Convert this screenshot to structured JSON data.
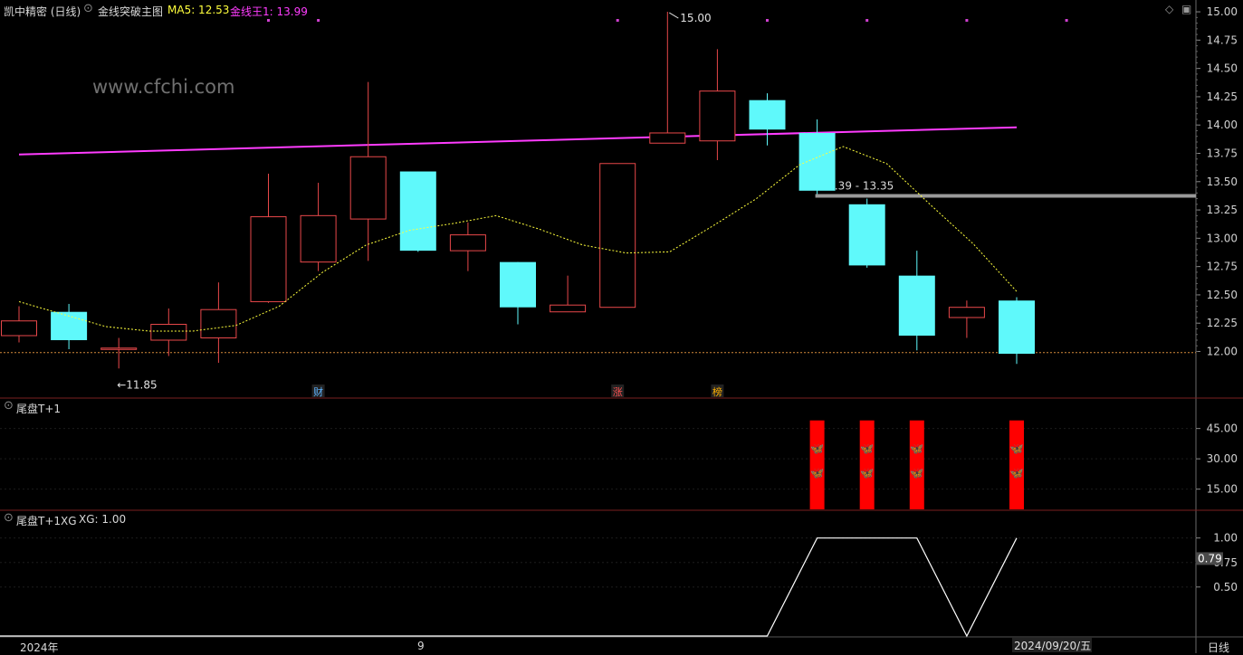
{
  "header": {
    "stock": "凯中精密 (日线)",
    "indicator": "金线突破主图",
    "ma5_label": "MA5: 12.53",
    "gold_label": "金线王1: 13.99"
  },
  "watermark": "www.cfchi.com",
  "panel2": {
    "title": "尾盘T+1"
  },
  "panel3": {
    "title": "尾盘T+1XG",
    "value_label": "XG: 1.00",
    "current_value": "0.79"
  },
  "xaxis": {
    "start_label": "2024年",
    "month_label": "9",
    "date_label": "2024/09/20/五",
    "period": "日线"
  },
  "colors": {
    "up": "#e8484a",
    "down": "#5ff9fb",
    "gold_line": "#ff3cff",
    "ma5": "#ffff3c",
    "signal_bar": "#ff0000",
    "xg_line": "#ffffff"
  },
  "chart_data": [
    {
      "type": "candlestick",
      "title": "金线突破主图",
      "ylim": [
        11.75,
        15.1
      ],
      "yticks": [
        "15.00",
        "14.75",
        "14.50",
        "14.25",
        "14.00",
        "13.75",
        "13.50",
        "13.25",
        "13.00",
        "12.75",
        "12.50",
        "12.25",
        "12.00"
      ],
      "candles": [
        {
          "o": 12.14,
          "h": 12.4,
          "l": 12.08,
          "c": 12.27
        },
        {
          "o": 12.35,
          "h": 12.42,
          "l": 12.02,
          "c": 12.1
        },
        {
          "o": 12.03,
          "h": 12.12,
          "l": 11.85,
          "c": 12.03
        },
        {
          "o": 12.1,
          "h": 12.38,
          "l": 11.96,
          "c": 12.24
        },
        {
          "o": 12.12,
          "h": 12.61,
          "l": 11.9,
          "c": 12.37
        },
        {
          "o": 12.44,
          "h": 13.57,
          "l": 12.43,
          "c": 13.19
        },
        {
          "o": 12.79,
          "h": 13.49,
          "l": 12.71,
          "c": 13.2
        },
        {
          "o": 13.17,
          "h": 14.38,
          "l": 12.8,
          "c": 13.72
        },
        {
          "o": 13.59,
          "h": 13.59,
          "l": 12.88,
          "c": 12.89
        },
        {
          "o": 12.89,
          "h": 13.14,
          "l": 12.71,
          "c": 13.03
        },
        {
          "o": 12.79,
          "h": 12.79,
          "l": 12.24,
          "c": 12.39
        },
        {
          "o": 12.35,
          "h": 12.67,
          "l": 12.35,
          "c": 12.41
        },
        {
          "o": 12.39,
          "h": 13.66,
          "l": 12.39,
          "c": 13.66
        },
        {
          "o": 13.84,
          "h": 15.0,
          "l": 13.84,
          "c": 13.93
        },
        {
          "o": 13.86,
          "h": 14.67,
          "l": 13.69,
          "c": 14.3
        },
        {
          "o": 14.22,
          "h": 14.28,
          "l": 13.82,
          "c": 13.96
        },
        {
          "o": 13.93,
          "h": 14.05,
          "l": 13.39,
          "c": 13.42
        },
        {
          "o": 13.3,
          "h": 13.35,
          "l": 12.74,
          "c": 12.76
        },
        {
          "o": 12.67,
          "h": 12.89,
          "l": 12.01,
          "c": 12.14
        },
        {
          "o": 12.3,
          "h": 12.45,
          "l": 12.12,
          "c": 12.39
        },
        {
          "o": 12.45,
          "h": 12.48,
          "l": 11.89,
          "c": 11.98
        }
      ],
      "ma5": [
        12.44,
        12.33,
        12.22,
        12.18,
        12.18,
        12.23,
        12.4,
        12.7,
        12.94,
        13.07,
        13.13,
        13.2,
        13.08,
        12.94,
        12.87,
        12.88,
        13.11,
        13.35,
        13.65,
        13.81,
        13.66,
        13.3,
        12.95,
        12.53
      ],
      "gold_line": {
        "start": 13.74,
        "end": 13.98
      },
      "annotations": {
        "high": "15.00",
        "low": "11.85",
        "range": "13.39 - 13.35",
        "range_value": 13.35,
        "baseline": 11.99
      },
      "markers": [
        {
          "index": 6,
          "label": "财",
          "color": "#5fb4ff"
        },
        {
          "index": 12,
          "label": "涨",
          "color": "#ff5050"
        },
        {
          "index": 14,
          "label": "榜",
          "color": "#ffb000"
        }
      ],
      "top_dots": [
        5,
        6,
        12,
        15,
        17,
        19,
        21
      ]
    },
    {
      "type": "bar",
      "title": "尾盘T+1",
      "ylim": [
        5,
        52
      ],
      "yticks": [
        "45.00",
        "30.00",
        "15.00"
      ],
      "bars": [
        {
          "index": 16,
          "value": 49
        },
        {
          "index": 17,
          "value": 49
        },
        {
          "index": 18,
          "value": 49
        },
        {
          "index": 20,
          "value": 49
        }
      ]
    },
    {
      "type": "line",
      "title": "尾盘T+1XG",
      "ylim": [
        0,
        1.08
      ],
      "yticks": [
        "1.00",
        "0.75",
        "0.50"
      ],
      "points": [
        [
          0,
          0
        ],
        [
          15,
          0
        ],
        [
          16,
          1
        ],
        [
          17,
          1
        ],
        [
          18,
          1
        ],
        [
          19,
          0
        ],
        [
          20,
          1
        ]
      ]
    }
  ]
}
